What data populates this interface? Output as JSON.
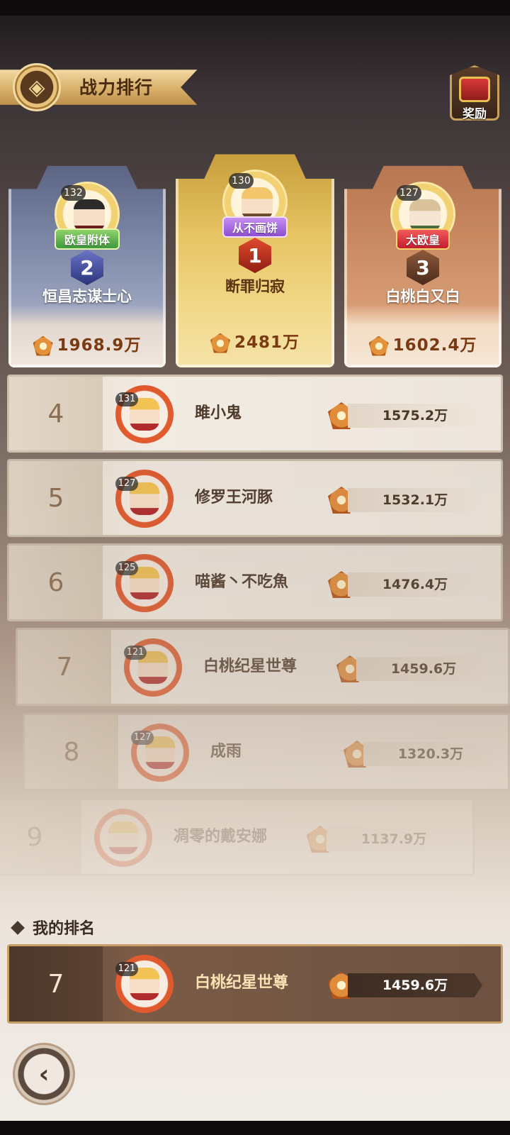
{
  "header": {
    "title": "战力排行",
    "reward_label": "奖励"
  },
  "podium": [
    {
      "rank": "2",
      "level": "132",
      "title_tag": "欧皇附体",
      "name": "恒昌志谋士心",
      "power": "1968.9万"
    },
    {
      "rank": "1",
      "level": "130",
      "title_tag": "从不画饼",
      "name": "断罪归寂",
      "power": "2481万"
    },
    {
      "rank": "3",
      "level": "127",
      "title_tag": "大欧皇",
      "name": "白桃白又白",
      "power": "1602.4万"
    }
  ],
  "rows": [
    {
      "rank": "4",
      "level": "131",
      "name": "雎小鬼",
      "power": "1575.2万"
    },
    {
      "rank": "5",
      "level": "127",
      "name": "修罗王河豚",
      "power": "1532.1万"
    },
    {
      "rank": "6",
      "level": "125",
      "name": "喵酱丶不吃魚",
      "power": "1476.4万"
    },
    {
      "rank": "7",
      "level": "121",
      "name": "白桃纪星世尊",
      "power": "1459.6万"
    },
    {
      "rank": "8",
      "level": "127",
      "name": "成雨",
      "power": "1320.3万"
    },
    {
      "rank": "9",
      "level": "",
      "name": "凋零的戴安娜",
      "power": "1137.9万"
    }
  ],
  "my_rank": {
    "section_title": "我的排名",
    "rank": "7",
    "level": "121",
    "name": "白桃纪星世尊",
    "power": "1459.6万"
  }
}
